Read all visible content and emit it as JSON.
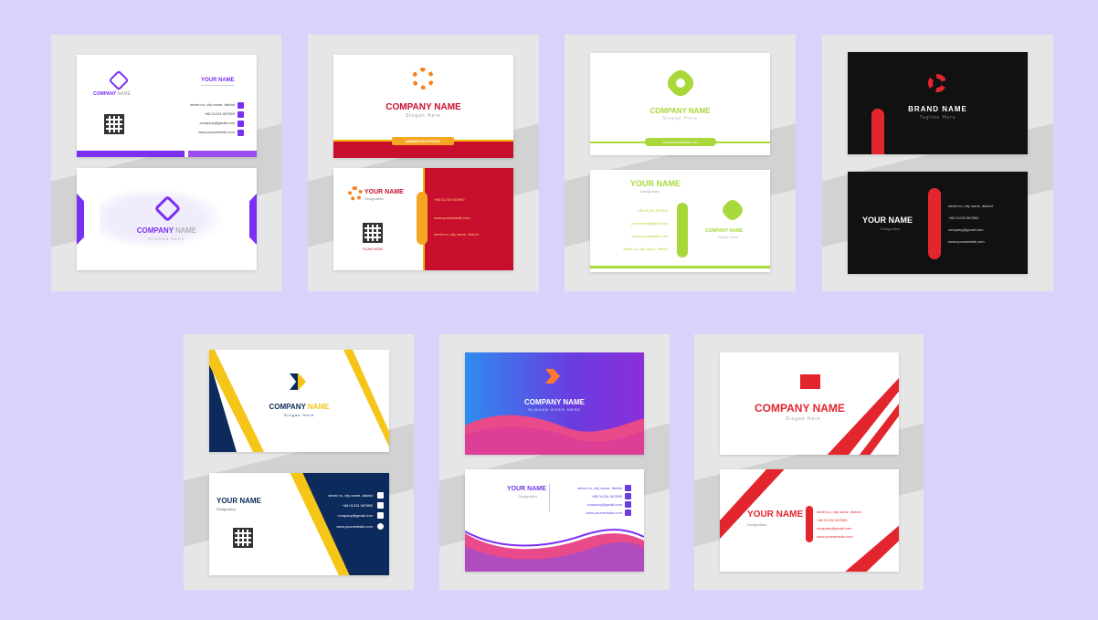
{
  "colors": {
    "background": "#d8d3fb",
    "purple": "#7b2ff2",
    "red": "#c8102e",
    "lime": "#a8d83a",
    "navy": "#0d2a5c",
    "yellow": "#f5c518"
  },
  "card1": {
    "your_name": "YOUR NAME",
    "company_a": "COMPANY",
    "company_b": "NAME",
    "address": "street no, city name, district",
    "phone": "+88 01234 567890",
    "email": "company@gmail.com",
    "website": "www.yourwebsite.com",
    "back_company_a": "COMPANY",
    "back_company_b": "NAME",
    "back_slogan": "SLOGAN HERE"
  },
  "card2": {
    "company": "COMPANY NAME",
    "slogan": "Slogan Here",
    "ribbon": "ANIMATION STUDIO",
    "your_name": "YOUR NAME",
    "designation": "Designation",
    "phone": "+88 01234 567890",
    "website": "www.yourwebsite.com",
    "address": "street no, city name, district",
    "qr_label": "SCAN NOW"
  },
  "card3": {
    "company": "COMPANY NAME",
    "slogan": "Slogan Here",
    "bar_text": "www.yourwebsite.com",
    "your_name": "YOUR NAME",
    "designation": "Designation",
    "phone": "+88 01234 567890",
    "email": "yourname@gmail.com",
    "website": "www.yourwebsite.com",
    "address": "street no, city name, district",
    "back_company": "COMPANY NAME",
    "back_slogan": "Slogan Here"
  },
  "card4": {
    "brand": "BRAND NAME",
    "tagline": "Tagline Here",
    "your_name": "YOUR NAME",
    "designation": "Designation",
    "address": "street no, city name, district",
    "phone": "+88 01234 567890",
    "email": "company@gmail.com",
    "website": "www.yourwebsite.com"
  },
  "card5": {
    "company_a": "COMPANY",
    "company_b": "NAME",
    "slogan": "Slogan Here",
    "your_name": "YOUR NAME",
    "designation": "Designation",
    "address": "street no, city name, district",
    "phone": "+88 01234 567890",
    "email": "company@gmail.com",
    "website": "www.yourwebsite.com"
  },
  "card6": {
    "company": "COMPANY NAME",
    "slogan": "SLOGAN GOES HERE",
    "your_name": "YOUR NAME",
    "designation": "Designation",
    "address": "street no, city name, district",
    "phone": "+88 01234 567890",
    "email": "company@gmail.com",
    "website": "www.yourwebsite.com"
  },
  "card7": {
    "company": "COMPANY NAME",
    "slogan": "Slogan Here",
    "your_name": "YOUR NAME",
    "designation": "Designation",
    "address": "street no, city name, district",
    "phone": "+88 01234 567890",
    "email": "company@gmail.com",
    "website": "www.yourwebsite.com"
  }
}
